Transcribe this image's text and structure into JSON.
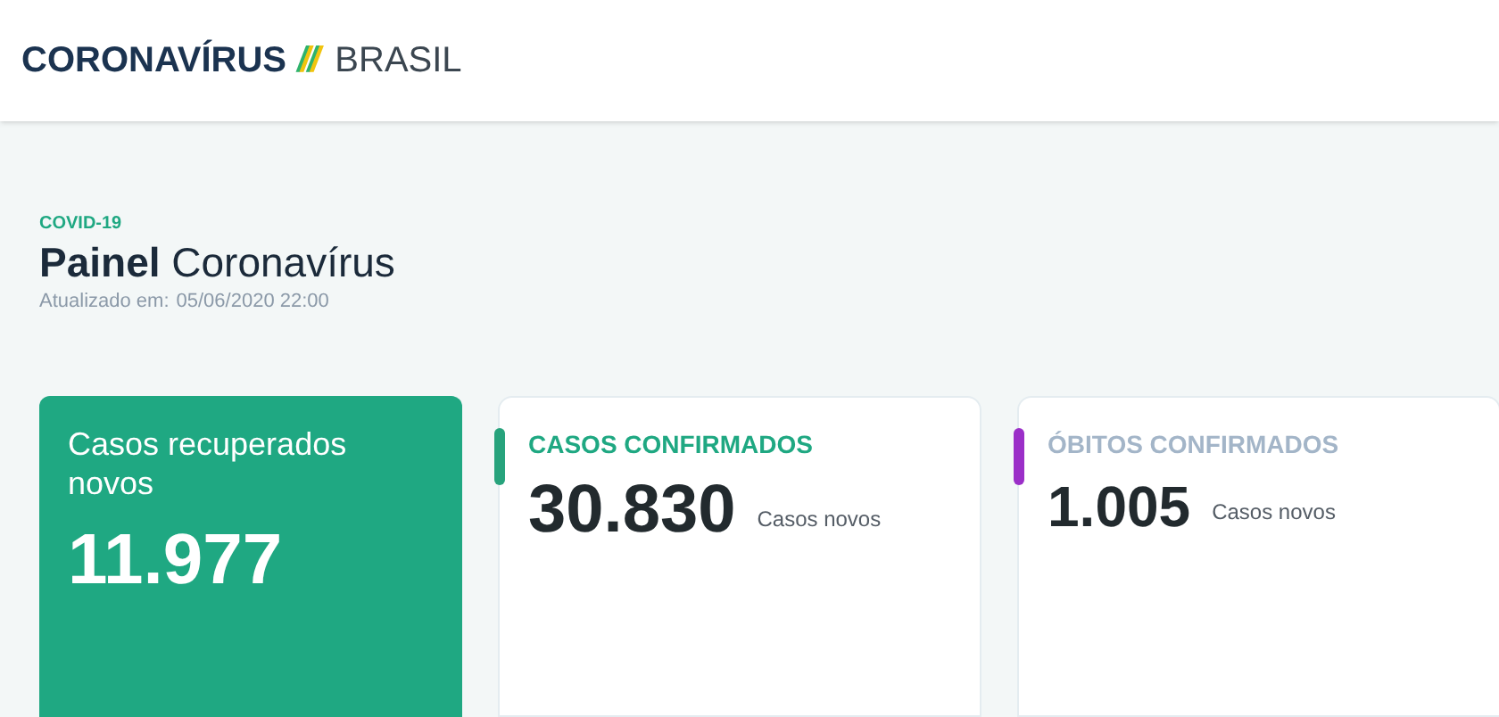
{
  "header": {
    "brand": "CORONAVÍRUS",
    "separator": "//",
    "country": "BRASIL"
  },
  "page": {
    "tag": "COVID-19",
    "title": "**Painel** Coronavírus",
    "updated_label": "Atualizado em:",
    "updated_value": "05/06/2020 22:00"
  },
  "cards": [
    {
      "kind": "featured",
      "title": "Casos recuperados novos",
      "value": "11.977"
    },
    {
      "kind": "stat",
      "title": "CASOS CONFIRMADOS",
      "title_highlighted": true,
      "color": "#27a37c",
      "value": "30.830",
      "caption": "Casos novos"
    },
    {
      "kind": "stat",
      "title": "ÓBITOS CONFIRMADOS",
      "title_highlighted": false,
      "color": "#9b2fc8",
      "value": "1.005",
      "caption": "Casos novos"
    }
  ]
}
